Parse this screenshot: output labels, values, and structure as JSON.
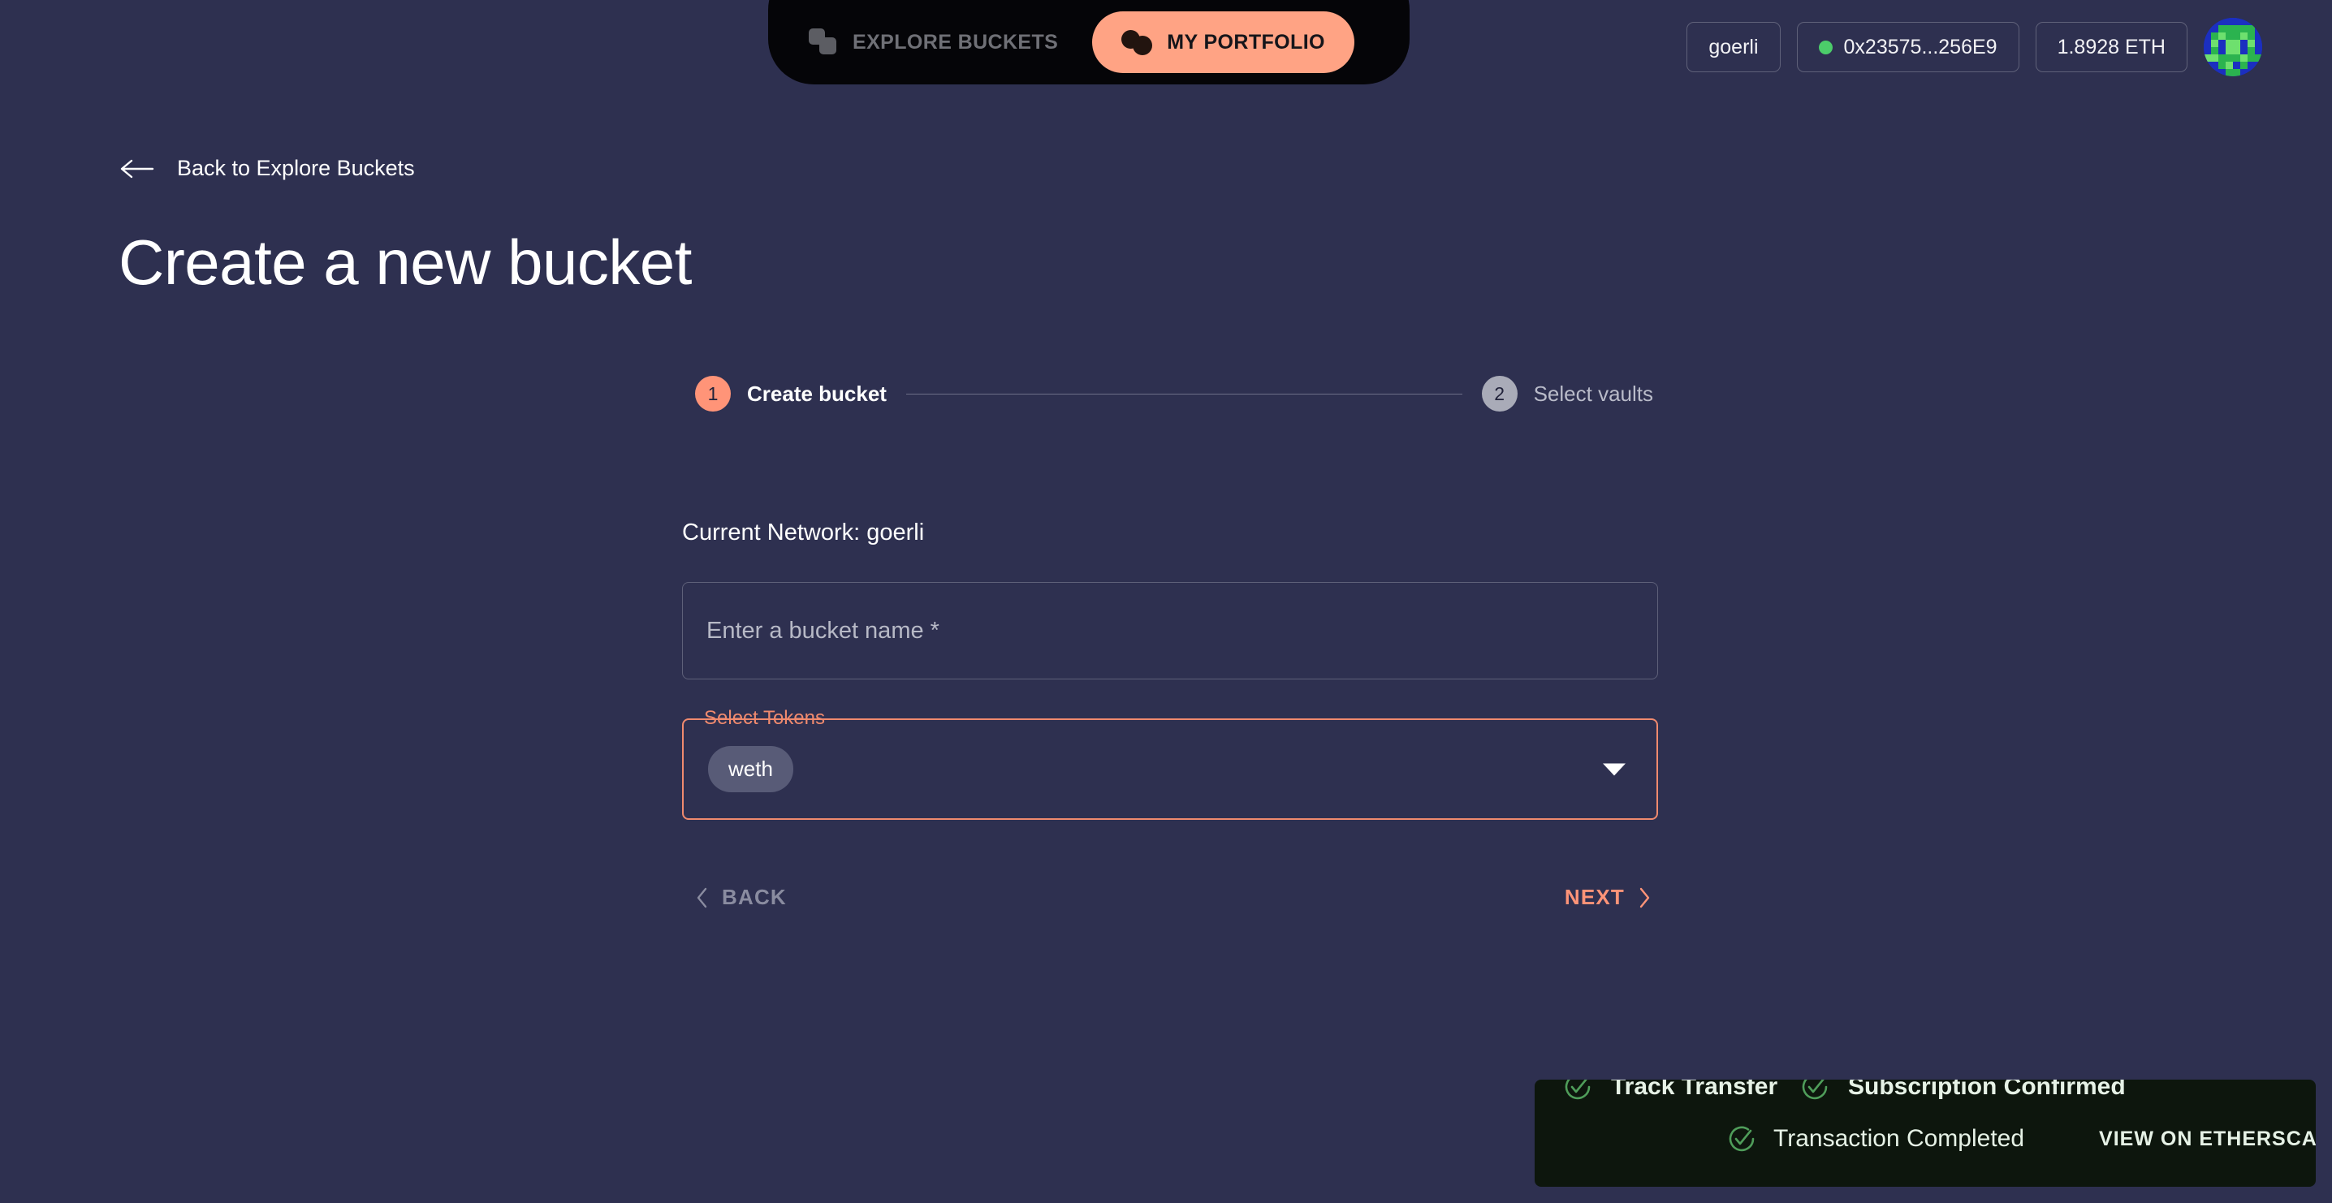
{
  "nav": {
    "tabs": [
      {
        "label": "EXPLORE BUCKETS",
        "icon": "buckets-icon",
        "active": false
      },
      {
        "label": "MY PORTFOLIO",
        "icon": "portfolio-coins-icon",
        "active": true
      }
    ]
  },
  "wallet": {
    "network": "goerli",
    "address": "0x23575...256E9",
    "balance": "1.8928 ETH",
    "status_color": "#4ccc6a",
    "avatar": "blockies-avatar"
  },
  "page": {
    "back_link": "Back to Explore Buckets",
    "title": "Create a new bucket"
  },
  "stepper": {
    "steps": [
      {
        "number": "1",
        "label": "Create bucket",
        "state": "active"
      },
      {
        "number": "2",
        "label": "Select vaults",
        "state": "inactive"
      }
    ]
  },
  "form": {
    "network_line": "Current Network: goerli",
    "bucket_name": {
      "value": "",
      "placeholder": "Enter a bucket name *"
    },
    "tokens": {
      "label": "Select Tokens",
      "selected": [
        "weth"
      ],
      "caret": "chevron-down-icon"
    }
  },
  "wizard": {
    "back_label": "BACK",
    "next_label": "NEXT",
    "back_enabled": false,
    "next_enabled": true
  },
  "toasts": {
    "items": [
      {
        "text": "Track Transfer",
        "icon": "check-circle-icon"
      },
      {
        "text": "Subscription Confirmed",
        "icon": "check-circle-icon"
      },
      {
        "text": "Transaction Completed",
        "icon": "check-circle-icon"
      }
    ],
    "action_label": "VIEW ON ETHERSCAN"
  },
  "colors": {
    "background": "#2e3050",
    "accent": "#ff9478",
    "accent_border": "#f08a6e",
    "nav_pill": "#050508",
    "toast_bg": "#0d160d",
    "success": "#4f9d5a"
  }
}
